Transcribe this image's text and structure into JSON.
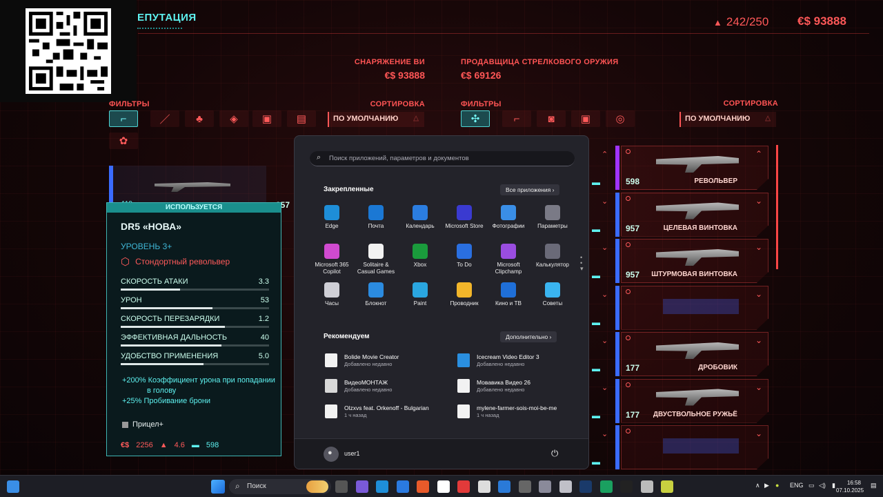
{
  "game": {
    "reputation_title": "ЕПУТАЦИЯ",
    "capacity": "242/250",
    "money": "€$ 93888",
    "left_panel": {
      "title": "СНАРЯЖЕНИЕ ВИ",
      "money": "€$ 93888",
      "filters": "ФИЛЬТРЫ",
      "sort": "СОРТИРОВКА",
      "sort_value": "ПО УМОЛЧАНИЮ"
    },
    "right_panel": {
      "title": "ПРОДАВЩИЦА СТРЕЛКОВОГО ОРУЖИЯ",
      "money": "€$ 69126",
      "filters": "ФИЛЬТРЫ",
      "sort": "СОРТИРОВКА",
      "sort_value": "ПО УМОЛЧАНИЮ"
    },
    "behind_card": {
      "num1": "119",
      "num2": "957"
    },
    "item_card": {
      "in_use": "ИСПОЛЬЗУЕТСЯ",
      "name": "DR5 «НОВА»",
      "level": "УРОВЕНЬ 3+",
      "type": "Стондортный револьвер",
      "stats": [
        {
          "label": "СКОРОСТЬ АТАКИ",
          "value": "3.3",
          "fill": 0.4
        },
        {
          "label": "УРОН",
          "value": "53",
          "fill": 0.62
        },
        {
          "label": "СКОРОСТЬ ПЕРЕЗАРЯДКИ",
          "value": "1.2",
          "fill": 0.7
        },
        {
          "label": "ЭФФЕКТИВНАЯ ДАЛЬНОСТЬ",
          "value": "40",
          "fill": 0.68
        },
        {
          "label": "УДОБСТВО ПРИМЕНЕНИЯ",
          "value": "5.0",
          "fill": 0.56
        }
      ],
      "perk1": "+200% Коэффициент урона при попадании",
      "perk1b": "в голову",
      "perk2": "+25% Пробивание брони",
      "mod": "Прицел+",
      "price": "2256",
      "weight": "4.6",
      "dps": "598"
    },
    "vendor_items": [
      {
        "num": "598",
        "label": "РЕВОЛЬВЕР",
        "strip": "#a033ff"
      },
      {
        "num": "957",
        "label": "ЦЕЛЕВАЯ ВИНТОВКА",
        "strip": "#3a6bff"
      },
      {
        "num": "957",
        "label": "ШТУРМОВАЯ ВИНТОВКА",
        "strip": "#3a6bff"
      },
      {
        "num": "",
        "label": "",
        "strip": "#3a6bff"
      },
      {
        "num": "177",
        "label": "ДРОБОВИК",
        "strip": "#3a6bff"
      },
      {
        "num": "177",
        "label": "ДВУСТВОЛЬНОЕ РУЖЬЁ",
        "strip": "#3a6bff"
      },
      {
        "num": "",
        "label": "",
        "strip": "#3a6bff"
      }
    ]
  },
  "start_menu": {
    "search_placeholder": "Поиск приложений, параметров и документов",
    "pinned_title": "Закрепленные",
    "all_apps": "Все приложения  ›",
    "apps": [
      {
        "label": "Edge",
        "color": "#1e8ed8"
      },
      {
        "label": "Почта",
        "color": "#1b78d4"
      },
      {
        "label": "Календарь",
        "color": "#2b7de0"
      },
      {
        "label": "Microsoft Store",
        "color": "#3a3ad0"
      },
      {
        "label": "Фотографии",
        "color": "#3a8ee6"
      },
      {
        "label": "Параметры",
        "color": "#7a7a86"
      },
      {
        "label": "Microsoft 365 Copilot",
        "color": "#d04ad0"
      },
      {
        "label": "Solitaire & Casual Games",
        "color": "#f2f2f2"
      },
      {
        "label": "Xbox",
        "color": "#1a9b3c"
      },
      {
        "label": "To Do",
        "color": "#2a6fe0"
      },
      {
        "label": "Microsoft Clipchamp",
        "color": "#9a4de0"
      },
      {
        "label": "Калькулятор",
        "color": "#6a6a78"
      },
      {
        "label": "Часы",
        "color": "#cfcfd6"
      },
      {
        "label": "Блокнот",
        "color": "#2b8be0"
      },
      {
        "label": "Paint",
        "color": "#2aa6e0"
      },
      {
        "label": "Проводник",
        "color": "#f2b62a"
      },
      {
        "label": "Кино и ТВ",
        "color": "#1f6fd8"
      },
      {
        "label": "Советы",
        "color": "#3ab4f0"
      }
    ],
    "recommended_title": "Рекомендуем",
    "more": "Дополнительно  ›",
    "recommended": [
      {
        "title": "Bolide Movie Creator",
        "sub": "Добавлено недавно",
        "color": "#f2f2f2"
      },
      {
        "title": "Icecream Video Editor 3",
        "sub": "Добавлено недавно",
        "color": "#2a8fe0"
      },
      {
        "title": "ВидеоМОНТАЖ",
        "sub": "Добавлено недавно",
        "color": "#d8d8d8"
      },
      {
        "title": "Мовавика Видео 26",
        "sub": "Добавлено недавно",
        "color": "#f2f2f2"
      },
      {
        "title": "Olzxvs feat. Orkenoff - Bulgarian",
        "sub": "1 ч назад",
        "color": "#f2f2f2"
      },
      {
        "title": "mylene-farmer-sois-moi-be-me",
        "sub": "1 ч назад",
        "color": "#f2f2f2"
      }
    ],
    "user": "user1"
  },
  "taskbar": {
    "search": "Поиск",
    "lang": "ENG",
    "time": "16:58",
    "date": "07.10.2025"
  }
}
